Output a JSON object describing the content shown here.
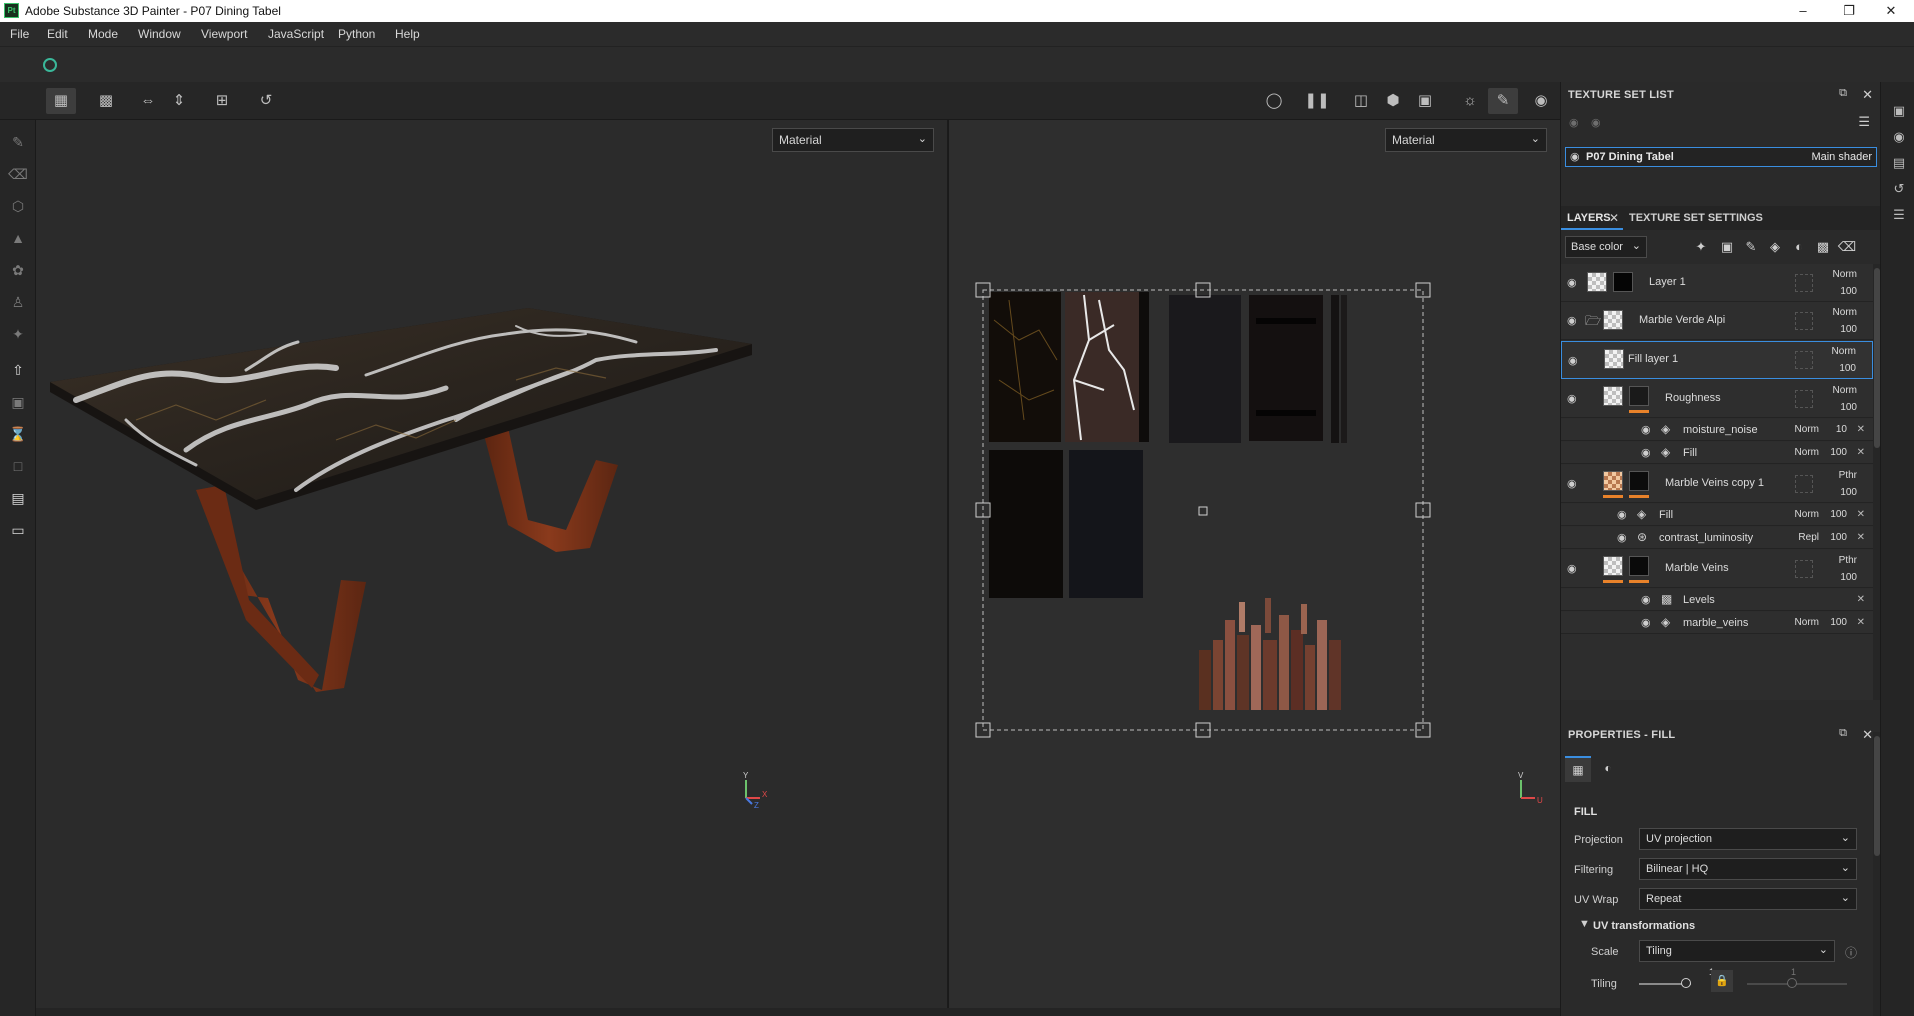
{
  "window": {
    "title": "Adobe Substance 3D Painter - P07 Dining Tabel",
    "app_icon": "Pt"
  },
  "menu": [
    "File",
    "Edit",
    "Mode",
    "Window",
    "Viewport",
    "JavaScript",
    "Python",
    "Help"
  ],
  "viewport_3d": {
    "mode": "Material",
    "axis": {
      "y": "Y",
      "x": "X",
      "z": "Z"
    }
  },
  "viewport_2d": {
    "mode": "Material",
    "axis": {
      "v": "V",
      "u": "U"
    }
  },
  "texture_set_list": {
    "title": "TEXTURE SET LIST",
    "item": {
      "name": "P07 Dining Tabel",
      "shader": "Main shader"
    }
  },
  "layers_panel": {
    "tabs": [
      "LAYERS",
      "TEXTURE SET SETTINGS"
    ],
    "channel": "Base color",
    "rows": [
      {
        "name": "Layer 1",
        "mode": "Norm",
        "opacity": "100"
      },
      {
        "name": "Marble Verde Alpi",
        "mode": "Norm",
        "opacity": "100"
      },
      {
        "name": "Fill layer 1",
        "mode": "Norm",
        "opacity": "100"
      },
      {
        "name": "Roughness",
        "mode": "Norm",
        "opacity": "100"
      },
      {
        "name": "moisture_noise",
        "mode": "Norm",
        "opacity": "10"
      },
      {
        "name": "Fill",
        "mode": "Norm",
        "opacity": "100"
      },
      {
        "name": "Marble Veins copy 1",
        "mode": "Pthr",
        "opacity": "100"
      },
      {
        "name": "Fill",
        "mode": "Norm",
        "opacity": "100"
      },
      {
        "name": "contrast_luminosity",
        "mode": "Repl",
        "opacity": "100"
      },
      {
        "name": "Marble Veins",
        "mode": "Pthr",
        "opacity": "100"
      },
      {
        "name": "Levels",
        "mode": "",
        "opacity": ""
      },
      {
        "name": "marble_veins",
        "mode": "Norm",
        "opacity": "100"
      }
    ]
  },
  "properties": {
    "title": "PROPERTIES - FILL",
    "section": "FILL",
    "projection_label": "Projection",
    "projection": "UV projection",
    "filtering_label": "Filtering",
    "filtering": "Bilinear | HQ",
    "uvwrap_label": "UV Wrap",
    "uvwrap": "Repeat",
    "uvtrans_label": "UV transformations",
    "scale_label": "Scale",
    "scale": "Tiling",
    "tiling_label": "Tiling",
    "tiling_val1": "1",
    "tiling_val2": "1"
  },
  "colors": {
    "accent": "#3a8ee0",
    "orange": "#e8822a",
    "sync": "#3ab89a"
  }
}
